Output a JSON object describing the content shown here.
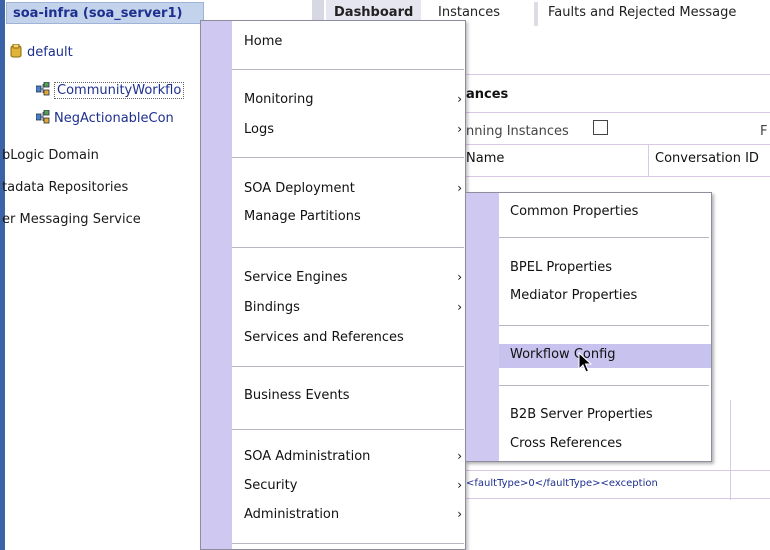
{
  "nav": {
    "root_label": "soa-infra (soa_server1)",
    "partition_label": "default",
    "composites": [
      "CommunityWorkflo",
      "NegActionableCon"
    ],
    "weblogic_label": "bLogic Domain",
    "metadata_label": "tadata Repositories",
    "messaging_label": "er Messaging Service",
    "brand_color": "#3b63a8"
  },
  "tabs": [
    "Dashboard",
    "Instances",
    "Faults and Rejected Message"
  ],
  "content": {
    "section_title": "ances",
    "running_label": "nning Instances",
    "truncated_label": "F",
    "col_name": "Name",
    "col_conversation": "Conversation ID",
    "fault_text": "<faultType>0</faultType><exception"
  },
  "context_menu": {
    "items": [
      {
        "label": "Home",
        "has_submenu": false
      },
      {
        "label": "Monitoring",
        "has_submenu": true
      },
      {
        "label": "Logs",
        "has_submenu": true
      },
      {
        "label": "SOA Deployment",
        "has_submenu": true
      },
      {
        "label": "Manage Partitions",
        "has_submenu": false
      },
      {
        "label": "Service Engines",
        "has_submenu": true
      },
      {
        "label": "Bindings",
        "has_submenu": true
      },
      {
        "label": "Services and References",
        "has_submenu": false
      },
      {
        "label": "Business Events",
        "has_submenu": false
      },
      {
        "label": "SOA Administration",
        "has_submenu": true
      },
      {
        "label": "Security",
        "has_submenu": true
      },
      {
        "label": "Administration",
        "has_submenu": true
      }
    ],
    "submenu_arrow": "›"
  },
  "submenu": {
    "items": [
      {
        "label": "Common Properties",
        "highlighted": false
      },
      {
        "label": "BPEL Properties",
        "highlighted": false
      },
      {
        "label": "Mediator Properties",
        "highlighted": false
      },
      {
        "label": "Workflow Config",
        "highlighted": true
      },
      {
        "label": "B2B Server Properties",
        "highlighted": false
      },
      {
        "label": "Cross References",
        "highlighted": false
      }
    ],
    "highlight_color": "#c8c2ef",
    "gutter_color": "#cfc9f2"
  }
}
